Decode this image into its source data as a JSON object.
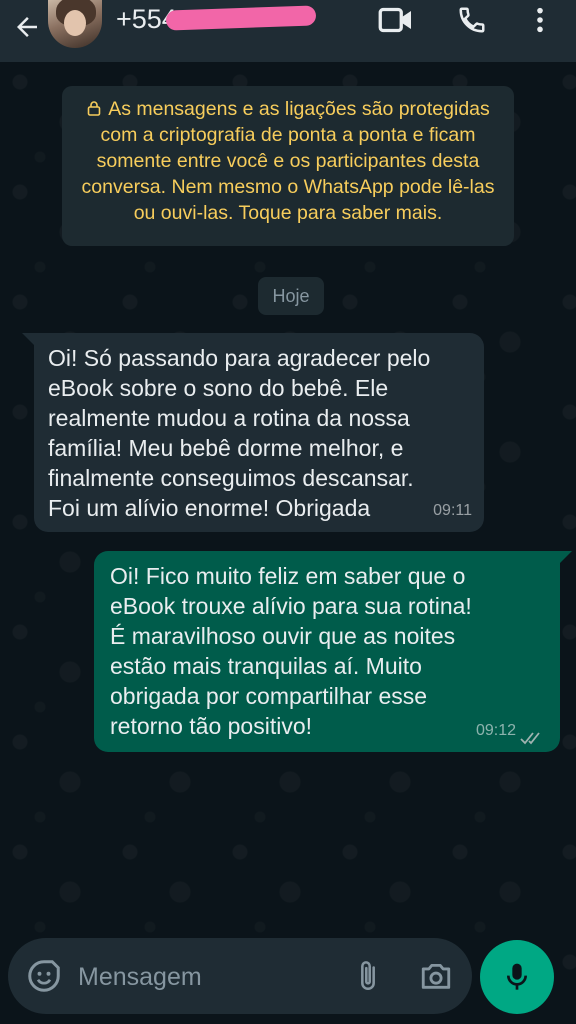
{
  "header": {
    "contact_name": "+554",
    "icons": [
      "back-arrow-icon",
      "video-call-icon",
      "voice-call-icon",
      "more-options-icon"
    ]
  },
  "notice": {
    "text": "As mensagens e as ligações são protegidas com a criptografia de ponta a ponta e ficam somente entre você e os participantes desta conversa. Nem mesmo o WhatsApp pode lê-las ou ouvi-las. Toque para saber mais.",
    "color": "#f7cd5c"
  },
  "date_label": "Hoje",
  "messages": [
    {
      "direction": "incoming",
      "lines": [
        "Oi! Só passando para agradecer pelo",
        "eBook sobre o sono do bebê. Ele",
        "realmente mudou a rotina da nossa",
        "família! Meu bebê dorme melhor, e",
        "finalmente conseguimos descansar.",
        "Foi um alívio enorme! Obrigada"
      ],
      "time": "09:11"
    },
    {
      "direction": "outgoing",
      "lines": [
        "Oi! Fico muito feliz em saber que o",
        "eBook trouxe alívio para sua rotina!",
        "É maravilhoso ouvir que as noites",
        "estão mais tranquilas aí. Muito",
        "obrigada por compartilhar esse",
        "retorno tão positivo!"
      ],
      "time": "09:12",
      "status": "read"
    }
  ],
  "composer": {
    "placeholder": "Mensagem"
  },
  "colors": {
    "header_bg": "#1f2c34",
    "chat_bg": "#0b141a",
    "incoming_bubble": "#1f2c34",
    "outgoing_bubble": "#005c4b",
    "accent": "#00a884"
  }
}
